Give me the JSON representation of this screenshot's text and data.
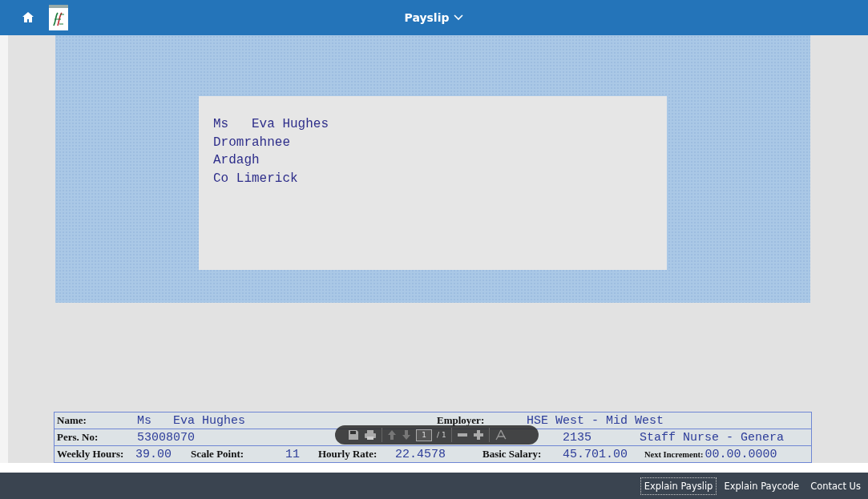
{
  "header": {
    "title": "Payslip"
  },
  "address": [
    "Ms   Eva Hughes",
    "Dromrahnee",
    "Ardagh",
    "Co Limerick"
  ],
  "details": [
    [
      {
        "label": "Name:",
        "value": "Ms   Eva Hughes"
      },
      {
        "label": "Employer:",
        "value": "HSE West - Mid West"
      }
    ],
    [
      {
        "label": "Pers. No:",
        "value": "53008070"
      },
      {
        "value": "2135"
      },
      {
        "value": "Staff Nurse - Genera"
      }
    ],
    [
      {
        "label": "Weekly Hours:",
        "value": "39.00"
      },
      {
        "label": "Scale Point:",
        "value": "11"
      },
      {
        "label": "Hourly Rate:",
        "value": "22.4578"
      },
      {
        "label": "Basic Salary:",
        "value": "45.701.00"
      },
      {
        "label": "Next Increment:",
        "value": "00.00.0000"
      }
    ]
  ],
  "viewer_toolbar": {
    "page": "1",
    "page_count": "/ 1"
  },
  "footer": {
    "links": [
      {
        "label": "Explain Payslip",
        "focused": true
      },
      {
        "label": "Explain Paycode",
        "focused": false
      },
      {
        "label": "Contact Us",
        "focused": false
      }
    ]
  }
}
